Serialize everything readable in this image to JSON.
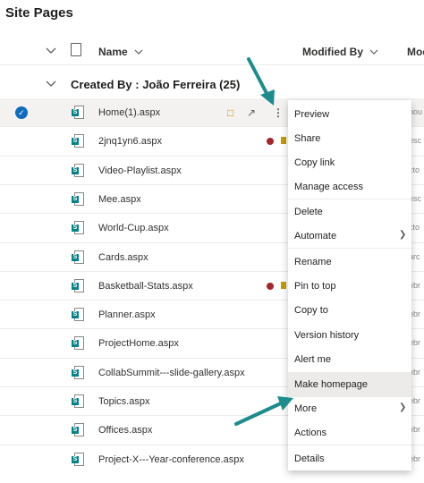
{
  "page_title": "Site Pages",
  "columns": {
    "name": "Name",
    "modified_by": "Modified By",
    "mod_trunc": "Mod"
  },
  "group": {
    "label": "Created By : João Ferreira (25)"
  },
  "rows": [
    {
      "name": "Home(1).aspx",
      "right": "pou"
    },
    {
      "name": "2jnq1yn6.aspx",
      "right": "esc"
    },
    {
      "name": "Video-Playlist.aspx",
      "right": "cto"
    },
    {
      "name": "Mee.aspx",
      "right": "esc"
    },
    {
      "name": "World-Cup.aspx",
      "right": "cto"
    },
    {
      "name": "Cards.aspx",
      "right": "arc"
    },
    {
      "name": "Basketball-Stats.aspx",
      "right": "ebr"
    },
    {
      "name": "Planner.aspx",
      "right": "ebr"
    },
    {
      "name": "ProjectHome.aspx",
      "right": "ebr"
    },
    {
      "name": "CollabSummit---slide-gallery.aspx",
      "right": "ebr"
    },
    {
      "name": "Topics.aspx",
      "right": "ebr"
    },
    {
      "name": "Offices.aspx",
      "right": "ebr"
    },
    {
      "name": "Project-X---Year-conference.aspx",
      "right": "ebr"
    }
  ],
  "menu": {
    "items": [
      "Preview",
      "Share",
      "Copy link",
      "Manage access",
      "Delete",
      "Automate",
      "Rename",
      "Pin to top",
      "Copy to",
      "Version history",
      "Alert me",
      "Make homepage",
      "More",
      "Actions",
      "Details"
    ],
    "highlighted": "Make homepage"
  },
  "colors": {
    "accent": "#0f6cbd",
    "arrow": "#1c8c8c",
    "sharepoint": "#038387"
  },
  "icons": [
    "checkmark-icon",
    "file-icon",
    "sharepoint-page-icon",
    "error-icon",
    "checkout-icon",
    "share-icon",
    "more-icon",
    "chevron-right-icon"
  ]
}
